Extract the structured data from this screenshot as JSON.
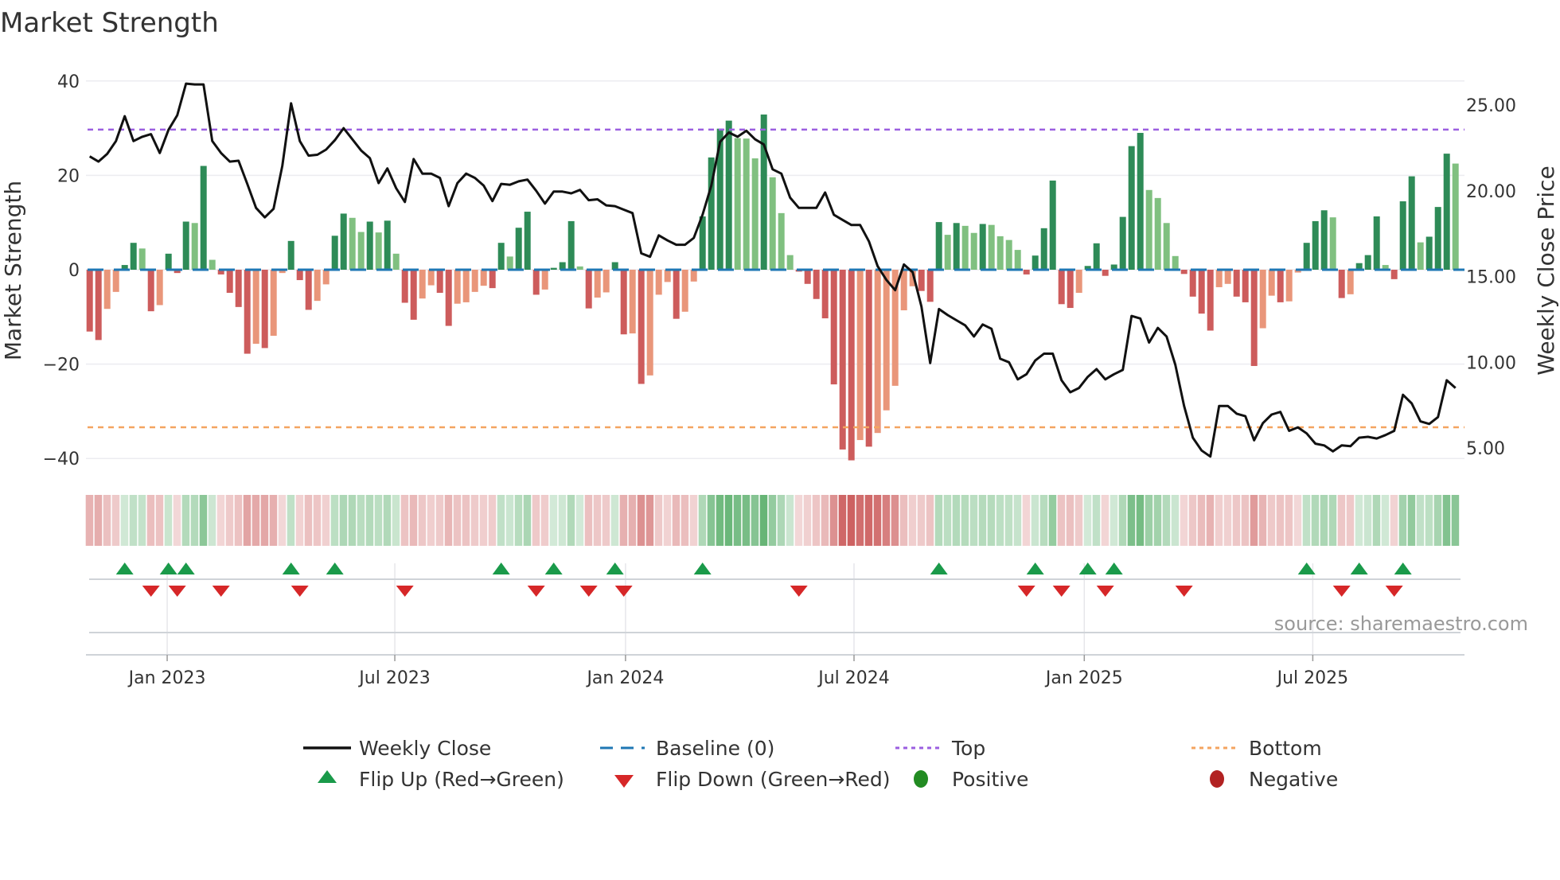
{
  "chart_data": {
    "type": "bar",
    "title": "Market Strength",
    "ylabel": "Market Strength",
    "ylabel_right": "Weekly Close Price",
    "ylim": [
      -42,
      42
    ],
    "yticks": [
      40,
      20,
      0,
      -20,
      -40
    ],
    "yticks_labels": [
      "40",
      "20",
      "0",
      "−20",
      "−40"
    ],
    "ylim_right": [
      3.8,
      27.8
    ],
    "yticks_right": [
      25,
      20,
      15,
      10,
      5
    ],
    "yticks_right_labels": [
      "25.00",
      "20.00",
      "15.00",
      "10.00",
      "5.00"
    ],
    "x_ticks": [
      {
        "label": "Jan 2023",
        "week": 8.85
      },
      {
        "label": "Jul 2023",
        "week": 34.85
      },
      {
        "label": "Jan 2024",
        "week": 61.2
      },
      {
        "label": "Jul 2024",
        "week": 87.3
      },
      {
        "label": "Jan 2025",
        "week": 113.6
      },
      {
        "label": "Jul 2025",
        "week": 139.7
      }
    ],
    "top_level": 29.7,
    "bottom_level": -33.4,
    "baseline": 0,
    "strength": [
      -13.1,
      -14.9,
      -8.3,
      -4.7,
      1.0,
      5.7,
      4.5,
      -8.8,
      -7.5,
      3.4,
      -0.7,
      10.2,
      9.9,
      22.0,
      2.1,
      -1.0,
      -4.9,
      -7.9,
      -17.8,
      -15.7,
      -16.6,
      -14.0,
      -0.7,
      6.1,
      -2.2,
      -8.5,
      -6.6,
      -3.1,
      7.2,
      11.9,
      11.0,
      8.0,
      10.2,
      7.9,
      10.4,
      3.4,
      -7.0,
      -10.6,
      -6.1,
      -3.3,
      -4.9,
      -11.9,
      -7.2,
      -6.9,
      -4.7,
      -3.4,
      -3.9,
      5.7,
      2.8,
      8.9,
      12.3,
      -5.3,
      -4.2,
      0.4,
      1.6,
      10.3,
      0.7,
      -8.2,
      -5.9,
      -4.8,
      1.6,
      -13.7,
      -13.5,
      -24.2,
      -22.4,
      -5.3,
      -2.6,
      -10.4,
      -8.9,
      -2.5,
      11.3,
      23.8,
      29.9,
      31.6,
      27.9,
      27.8,
      23.6,
      32.9,
      19.6,
      12.0,
      3.1,
      -0.4,
      -3.0,
      -6.2,
      -10.3,
      -24.3,
      -38.1,
      -40.4,
      -36.1,
      -37.5,
      -34.6,
      -29.8,
      -24.6,
      -8.6,
      -3.5,
      -4.5,
      -6.8,
      10.1,
      7.4,
      9.9,
      9.3,
      7.8,
      9.7,
      9.5,
      7.1,
      6.3,
      4.2,
      -1.0,
      3.0,
      8.8,
      18.9,
      -7.3,
      -8.1,
      -4.9,
      0.8,
      5.6,
      -1.3,
      1.1,
      11.2,
      26.2,
      29.0,
      16.9,
      15.2,
      9.9,
      2.9,
      -0.9,
      -5.7,
      -9.3,
      -12.9,
      -3.7,
      -3.0,
      -5.7,
      -6.9,
      -20.4,
      -12.4,
      -5.5,
      -6.9,
      -6.7,
      -0.6,
      5.7,
      10.3,
      12.6,
      11.1,
      -6.0,
      -5.2,
      1.4,
      3.1,
      11.3,
      1.0,
      -2.0,
      14.5,
      19.8,
      5.8,
      7.0,
      13.3,
      24.6,
      22.5
    ],
    "weekly_close": [
      22.0,
      21.7,
      22.15,
      22.9,
      24.35,
      22.9,
      23.15,
      23.3,
      22.2,
      23.55,
      24.4,
      26.25,
      26.2,
      26.2,
      22.9,
      22.2,
      21.7,
      21.75,
      20.4,
      19.0,
      18.45,
      18.95,
      21.45,
      25.1,
      22.9,
      22.05,
      22.1,
      22.4,
      22.95,
      23.65,
      23.0,
      22.35,
      21.9,
      20.45,
      21.3,
      20.15,
      19.35,
      21.85,
      21.0,
      21.0,
      20.75,
      19.1,
      20.45,
      21.0,
      20.75,
      20.3,
      19.4,
      20.4,
      20.35,
      20.55,
      20.65,
      20.0,
      19.25,
      19.95,
      19.95,
      19.85,
      20.05,
      19.45,
      19.5,
      19.15,
      19.1,
      18.9,
      18.7,
      16.35,
      16.15,
      17.4,
      17.1,
      16.85,
      16.85,
      17.25,
      18.6,
      20.3,
      22.85,
      23.4,
      23.15,
      23.5,
      23.0,
      22.7,
      21.25,
      21.0,
      19.6,
      19.0,
      19.0,
      19.0,
      19.9,
      18.6,
      18.3,
      18.0,
      18.0,
      17.05,
      15.6,
      14.8,
      14.2,
      15.7,
      15.25,
      13.25,
      9.95,
      13.1,
      12.75,
      12.45,
      12.15,
      11.5,
      12.2,
      11.95,
      10.2,
      10.0,
      9.0,
      9.3,
      10.1,
      10.5,
      10.5,
      8.95,
      8.25,
      8.5,
      9.15,
      9.6,
      9.0,
      9.3,
      9.55,
      12.7,
      12.55,
      11.15,
      12.0,
      11.5,
      9.85,
      7.45,
      5.6,
      4.85,
      4.5,
      7.45,
      7.45,
      7.0,
      6.85,
      5.45,
      6.45,
      6.95,
      7.1,
      6.0,
      6.2,
      5.85,
      5.25,
      5.15,
      4.8,
      5.15,
      5.1,
      5.6,
      5.65,
      5.55,
      5.75,
      6.0,
      8.1,
      7.6,
      6.55,
      6.4,
      6.8,
      8.95,
      8.5
    ],
    "colors": {
      "pos_strong": "#2e8b57",
      "pos_weak": "#80c080",
      "neg_strong": "#cd5c5c",
      "neg_weak": "#e9967a",
      "baseline": "#1f77b4",
      "top": "#9b5fe0",
      "bottom": "#f4a460",
      "line": "#111111",
      "flip_up": "#1a9a4a",
      "flip_down": "#d62728",
      "positive": "#228b22",
      "negative": "#b22222"
    },
    "legend": {
      "weekly_close": "Weekly Close",
      "baseline": "Baseline (0)",
      "top": "Top",
      "bottom": "Bottom",
      "flip_up": "Flip Up (Red→Green)",
      "flip_down": "Flip Down (Green→Red)",
      "positive": "Positive",
      "negative": "Negative"
    },
    "source": "source: sharemaestro.com"
  }
}
